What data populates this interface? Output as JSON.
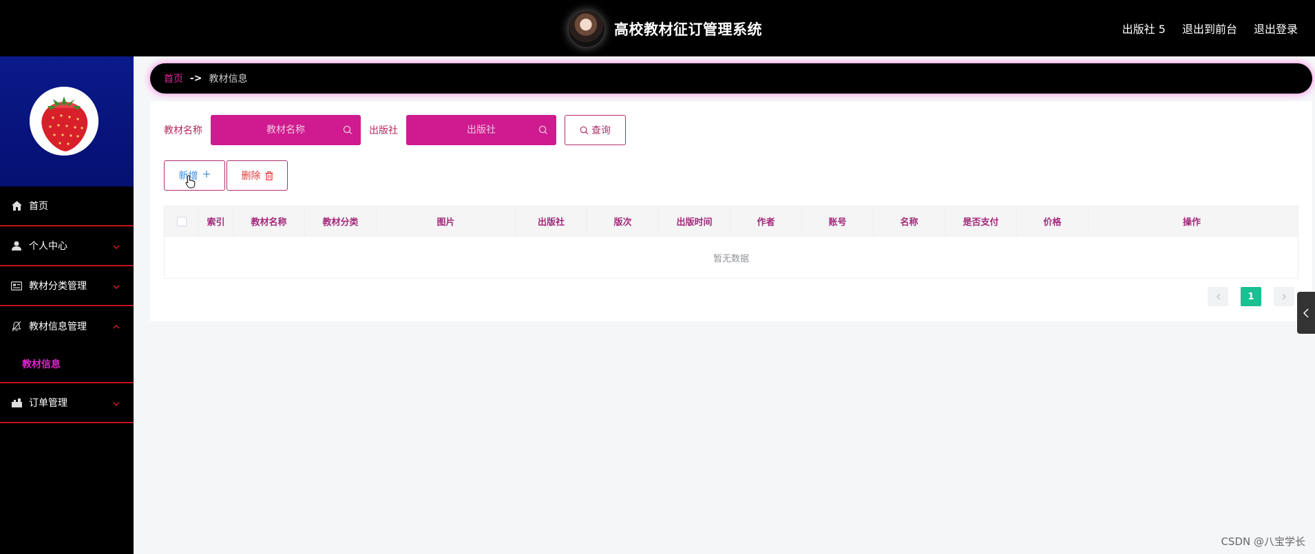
{
  "header": {
    "title": "高校教材征订管理系统",
    "links": [
      "出版社 5",
      "退出到前台",
      "退出登录"
    ]
  },
  "sidebar": {
    "items": [
      {
        "label": "首页",
        "icon": "home-icon"
      },
      {
        "label": "个人中心",
        "icon": "user-icon"
      },
      {
        "label": "教材分类管理",
        "icon": "category-icon"
      },
      {
        "label": "教材信息管理",
        "icon": "bell-off-icon",
        "expanded": true,
        "sub": [
          "教材信息"
        ]
      },
      {
        "label": "订单管理",
        "icon": "order-icon"
      }
    ]
  },
  "breadcrumb": {
    "home": "首页",
    "separator": "->",
    "current": "教材信息"
  },
  "search": {
    "name_label": "教材名称",
    "name_placeholder": "教材名称",
    "publisher_label": "出版社",
    "publisher_placeholder": "出版社",
    "query_button": "查询"
  },
  "actions": {
    "add_button": "新增",
    "delete_button": "删除"
  },
  "table": {
    "columns": [
      "索引",
      "教材名称",
      "教材分类",
      "图片",
      "出版社",
      "版次",
      "出版时间",
      "作者",
      "账号",
      "名称",
      "是否支付",
      "价格",
      "操作"
    ],
    "empty_text": "暂无数据"
  },
  "pagination": {
    "current_page": "1"
  },
  "watermark": "CSDN @八宝学长",
  "colors": {
    "accent_pink": "#cf1b8f",
    "menu_border": "#c2121c",
    "active_page": "#1bbf92",
    "profile_bg": "#061072"
  }
}
